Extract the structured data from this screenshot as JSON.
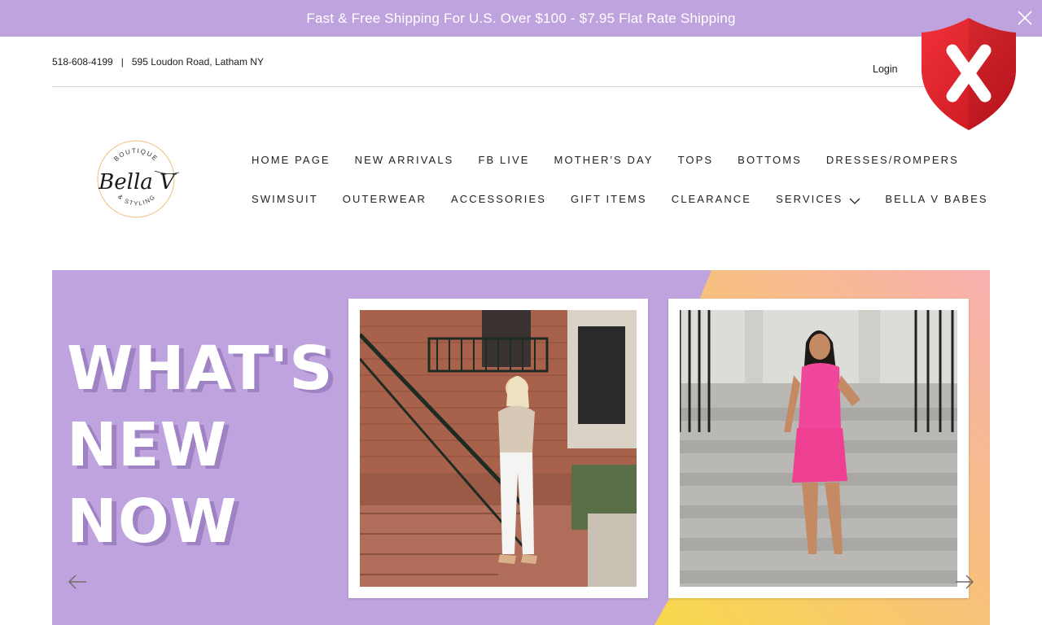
{
  "announcement": {
    "text": "Fast & Free Shipping For U.S. Over $100 - $7.95 Flat Rate Shipping"
  },
  "utility": {
    "phone": "518-608-4199",
    "separator": "|",
    "address": "595 Loudon Road, Latham NY",
    "login_label": "Login"
  },
  "logo": {
    "top_text": "BOUTIQUE",
    "main_text": "Bella V",
    "bottom_text": "& STYLING"
  },
  "nav": {
    "row1": [
      "HOME PAGE",
      "NEW ARRIVALS",
      "FB LIVE",
      "MOTHER'S DAY",
      "TOPS",
      "BOTTOMS",
      "DRESSES/ROMPERS"
    ],
    "row2": [
      "SWIMSUIT",
      "OUTERWEAR",
      "ACCESSORIES",
      "GIFT ITEMS",
      "CLEARANCE",
      "SERVICES",
      "BELLA V BABES"
    ]
  },
  "hero": {
    "headline": [
      "WHAT'S",
      "NEW",
      "NOW"
    ]
  },
  "colors": {
    "brand_lavender": "#bfa3de",
    "shield_red": "#e8202a"
  },
  "icons": {
    "announcement_close": "close-icon",
    "services_dropdown": "chevron-down-icon",
    "slider_prev": "arrow-left-icon",
    "slider_next": "arrow-right-icon",
    "security": "shield-x-icon"
  }
}
